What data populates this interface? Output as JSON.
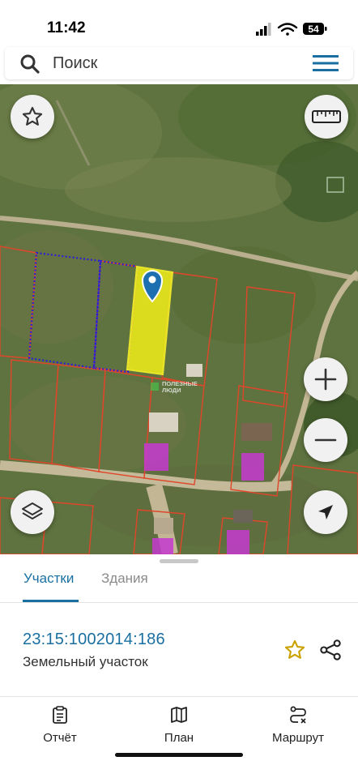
{
  "status_bar": {
    "time": "11:42",
    "battery": "54"
  },
  "search": {
    "placeholder": "Поиск",
    "icon": "search-icon",
    "menu_icon": "hamburger-menu-icon"
  },
  "map": {
    "watermark_line1": "ПОЛЕЗНЫЕ",
    "watermark_line2": "ЛЮДИ",
    "controls": {
      "favorite": "star-icon",
      "ruler": "ruler-icon",
      "zoom_in": "plus-icon",
      "zoom_out": "minus-icon",
      "layers": "layers-icon",
      "locate": "navigation-arrow-icon"
    },
    "colors": {
      "selected_parcel": "#f2ef1a",
      "parcel_border": "#e0462a",
      "dotted_parcel": "#2b1fd6",
      "building": "#c53ad0",
      "pin": "#1d6fb0"
    }
  },
  "sheet": {
    "tabs": [
      {
        "label": "Участки",
        "active": true
      },
      {
        "label": "Здания",
        "active": false
      }
    ],
    "cadastral_number": "23:15:1002014:186",
    "object_type": "Земельный участок"
  },
  "bottom_nav": [
    {
      "label": "Отчёт",
      "icon": "report-clipboard-icon"
    },
    {
      "label": "План",
      "icon": "map-plan-icon"
    },
    {
      "label": "Маршрут",
      "icon": "route-icon"
    }
  ]
}
